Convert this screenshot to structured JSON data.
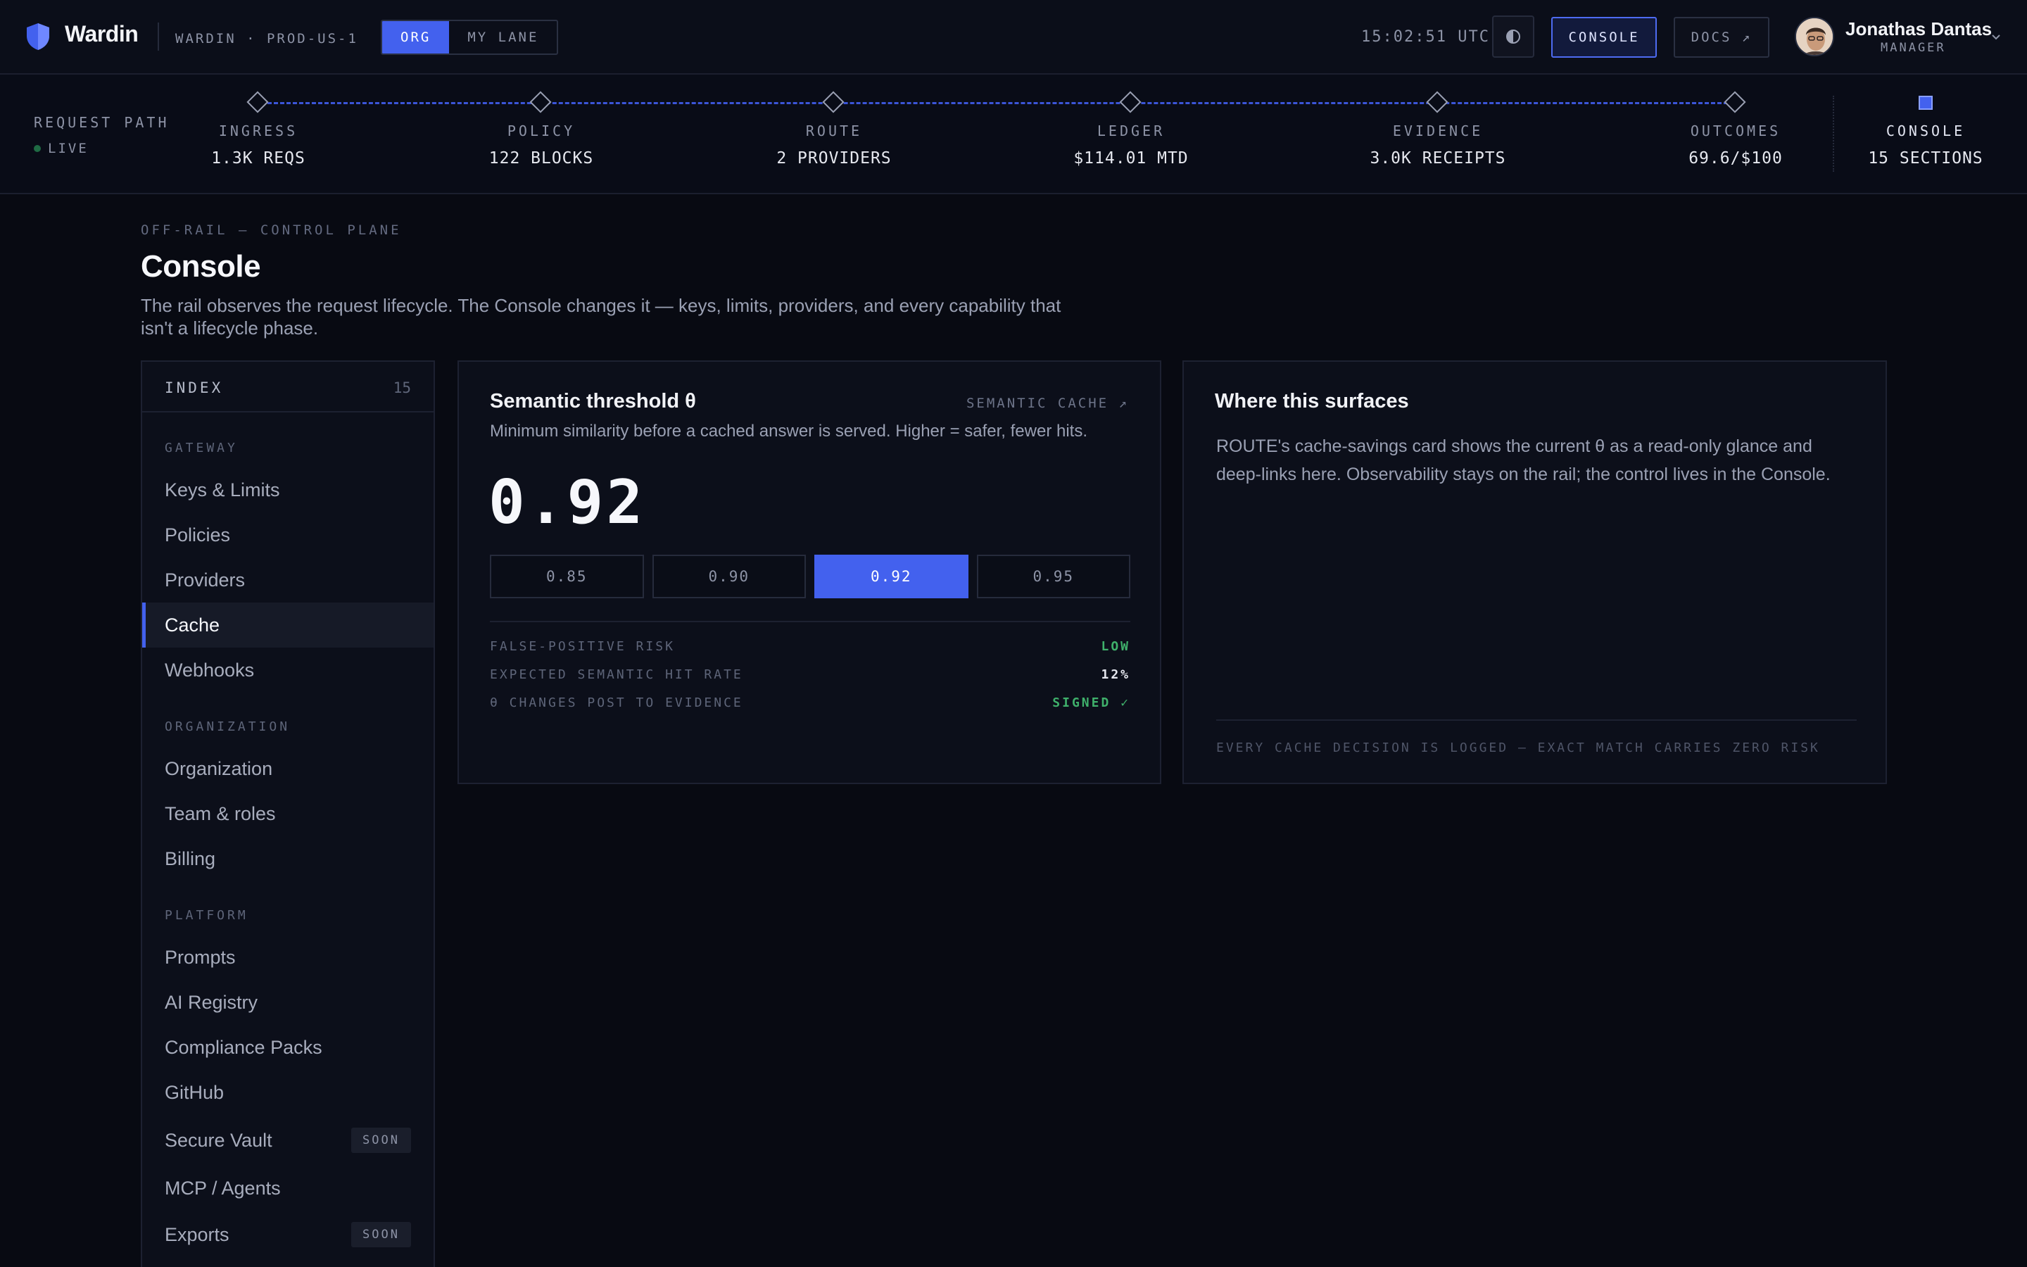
{
  "brand": {
    "name": "Wardin",
    "env": "WARDIN · PROD-US-1",
    "scope_tabs": [
      {
        "label": "ORG",
        "active": true
      },
      {
        "label": "MY LANE",
        "active": false
      }
    ]
  },
  "header": {
    "clock": "15:02:51 UTC",
    "console_label": "CONSOLE",
    "docs_label": "DOCS ↗",
    "user": {
      "name": "Jonathas Dantas",
      "role": "MANAGER"
    }
  },
  "request_path": {
    "title": "REQUEST PATH",
    "status": "LIVE",
    "steps": [
      {
        "name": "INGRESS",
        "value": "1.3K REQS"
      },
      {
        "name": "POLICY",
        "value": "122 BLOCKS"
      },
      {
        "name": "ROUTE",
        "value": "2 PROVIDERS"
      },
      {
        "name": "LEDGER",
        "value": "$114.01 MTD"
      },
      {
        "name": "EVIDENCE",
        "value": "3.0K RECEIPTS"
      },
      {
        "name": "OUTCOMES",
        "value": "69.6/$100"
      },
      {
        "name": "CONSOLE",
        "value": "15 SECTIONS",
        "active": true
      }
    ]
  },
  "page": {
    "eyebrow": "OFF-RAIL — CONTROL PLANE",
    "title": "Console",
    "description": "The rail observes the request lifecycle. The Console changes it — keys, limits, providers, and every capability that isn't a lifecycle phase."
  },
  "index": {
    "title": "INDEX",
    "count": "15",
    "groups": [
      {
        "label": "GATEWAY",
        "items": [
          {
            "label": "Keys & Limits"
          },
          {
            "label": "Policies"
          },
          {
            "label": "Providers"
          },
          {
            "label": "Cache",
            "active": true
          },
          {
            "label": "Webhooks"
          }
        ]
      },
      {
        "label": "ORGANIZATION",
        "items": [
          {
            "label": "Organization"
          },
          {
            "label": "Team & roles"
          },
          {
            "label": "Billing"
          }
        ]
      },
      {
        "label": "PLATFORM",
        "items": [
          {
            "label": "Prompts"
          },
          {
            "label": "AI Registry"
          },
          {
            "label": "Compliance Packs"
          },
          {
            "label": "GitHub"
          },
          {
            "label": "Secure Vault",
            "badge": "SOON"
          },
          {
            "label": "MCP / Agents"
          },
          {
            "label": "Exports",
            "badge": "SOON"
          }
        ]
      }
    ]
  },
  "threshold": {
    "title": "Semantic threshold θ",
    "link": "SEMANTIC CACHE ↗",
    "subtitle": "Minimum similarity before a cached answer is served. Higher = safer, fewer hits.",
    "value": "0.92",
    "options": [
      {
        "label": "0.85"
      },
      {
        "label": "0.90"
      },
      {
        "label": "0.92",
        "active": true
      },
      {
        "label": "0.95"
      }
    ],
    "stats": [
      {
        "label": "FALSE-POSITIVE RISK",
        "value": "LOW",
        "color": "#3fb06b"
      },
      {
        "label": "EXPECTED SEMANTIC HIT RATE",
        "value": "12%",
        "color": "#e6e8ef"
      },
      {
        "label": "θ CHANGES POST TO EVIDENCE",
        "value": "SIGNED ✓",
        "color": "#3fb06b"
      }
    ]
  },
  "surfaces": {
    "title": "Where this surfaces",
    "text": "ROUTE's cache-savings card shows the current θ as a read-only glance and deep-links here. Observability stays on the rail; the control lives in the Console.",
    "footer": "EVERY CACHE DECISION IS LOGGED — EXACT MATCH CARRIES ZERO RISK"
  },
  "colors": {
    "accent": "#4361ee",
    "success": "#3fb06b",
    "background": "#080a12",
    "panel": "#0c0f1a"
  }
}
